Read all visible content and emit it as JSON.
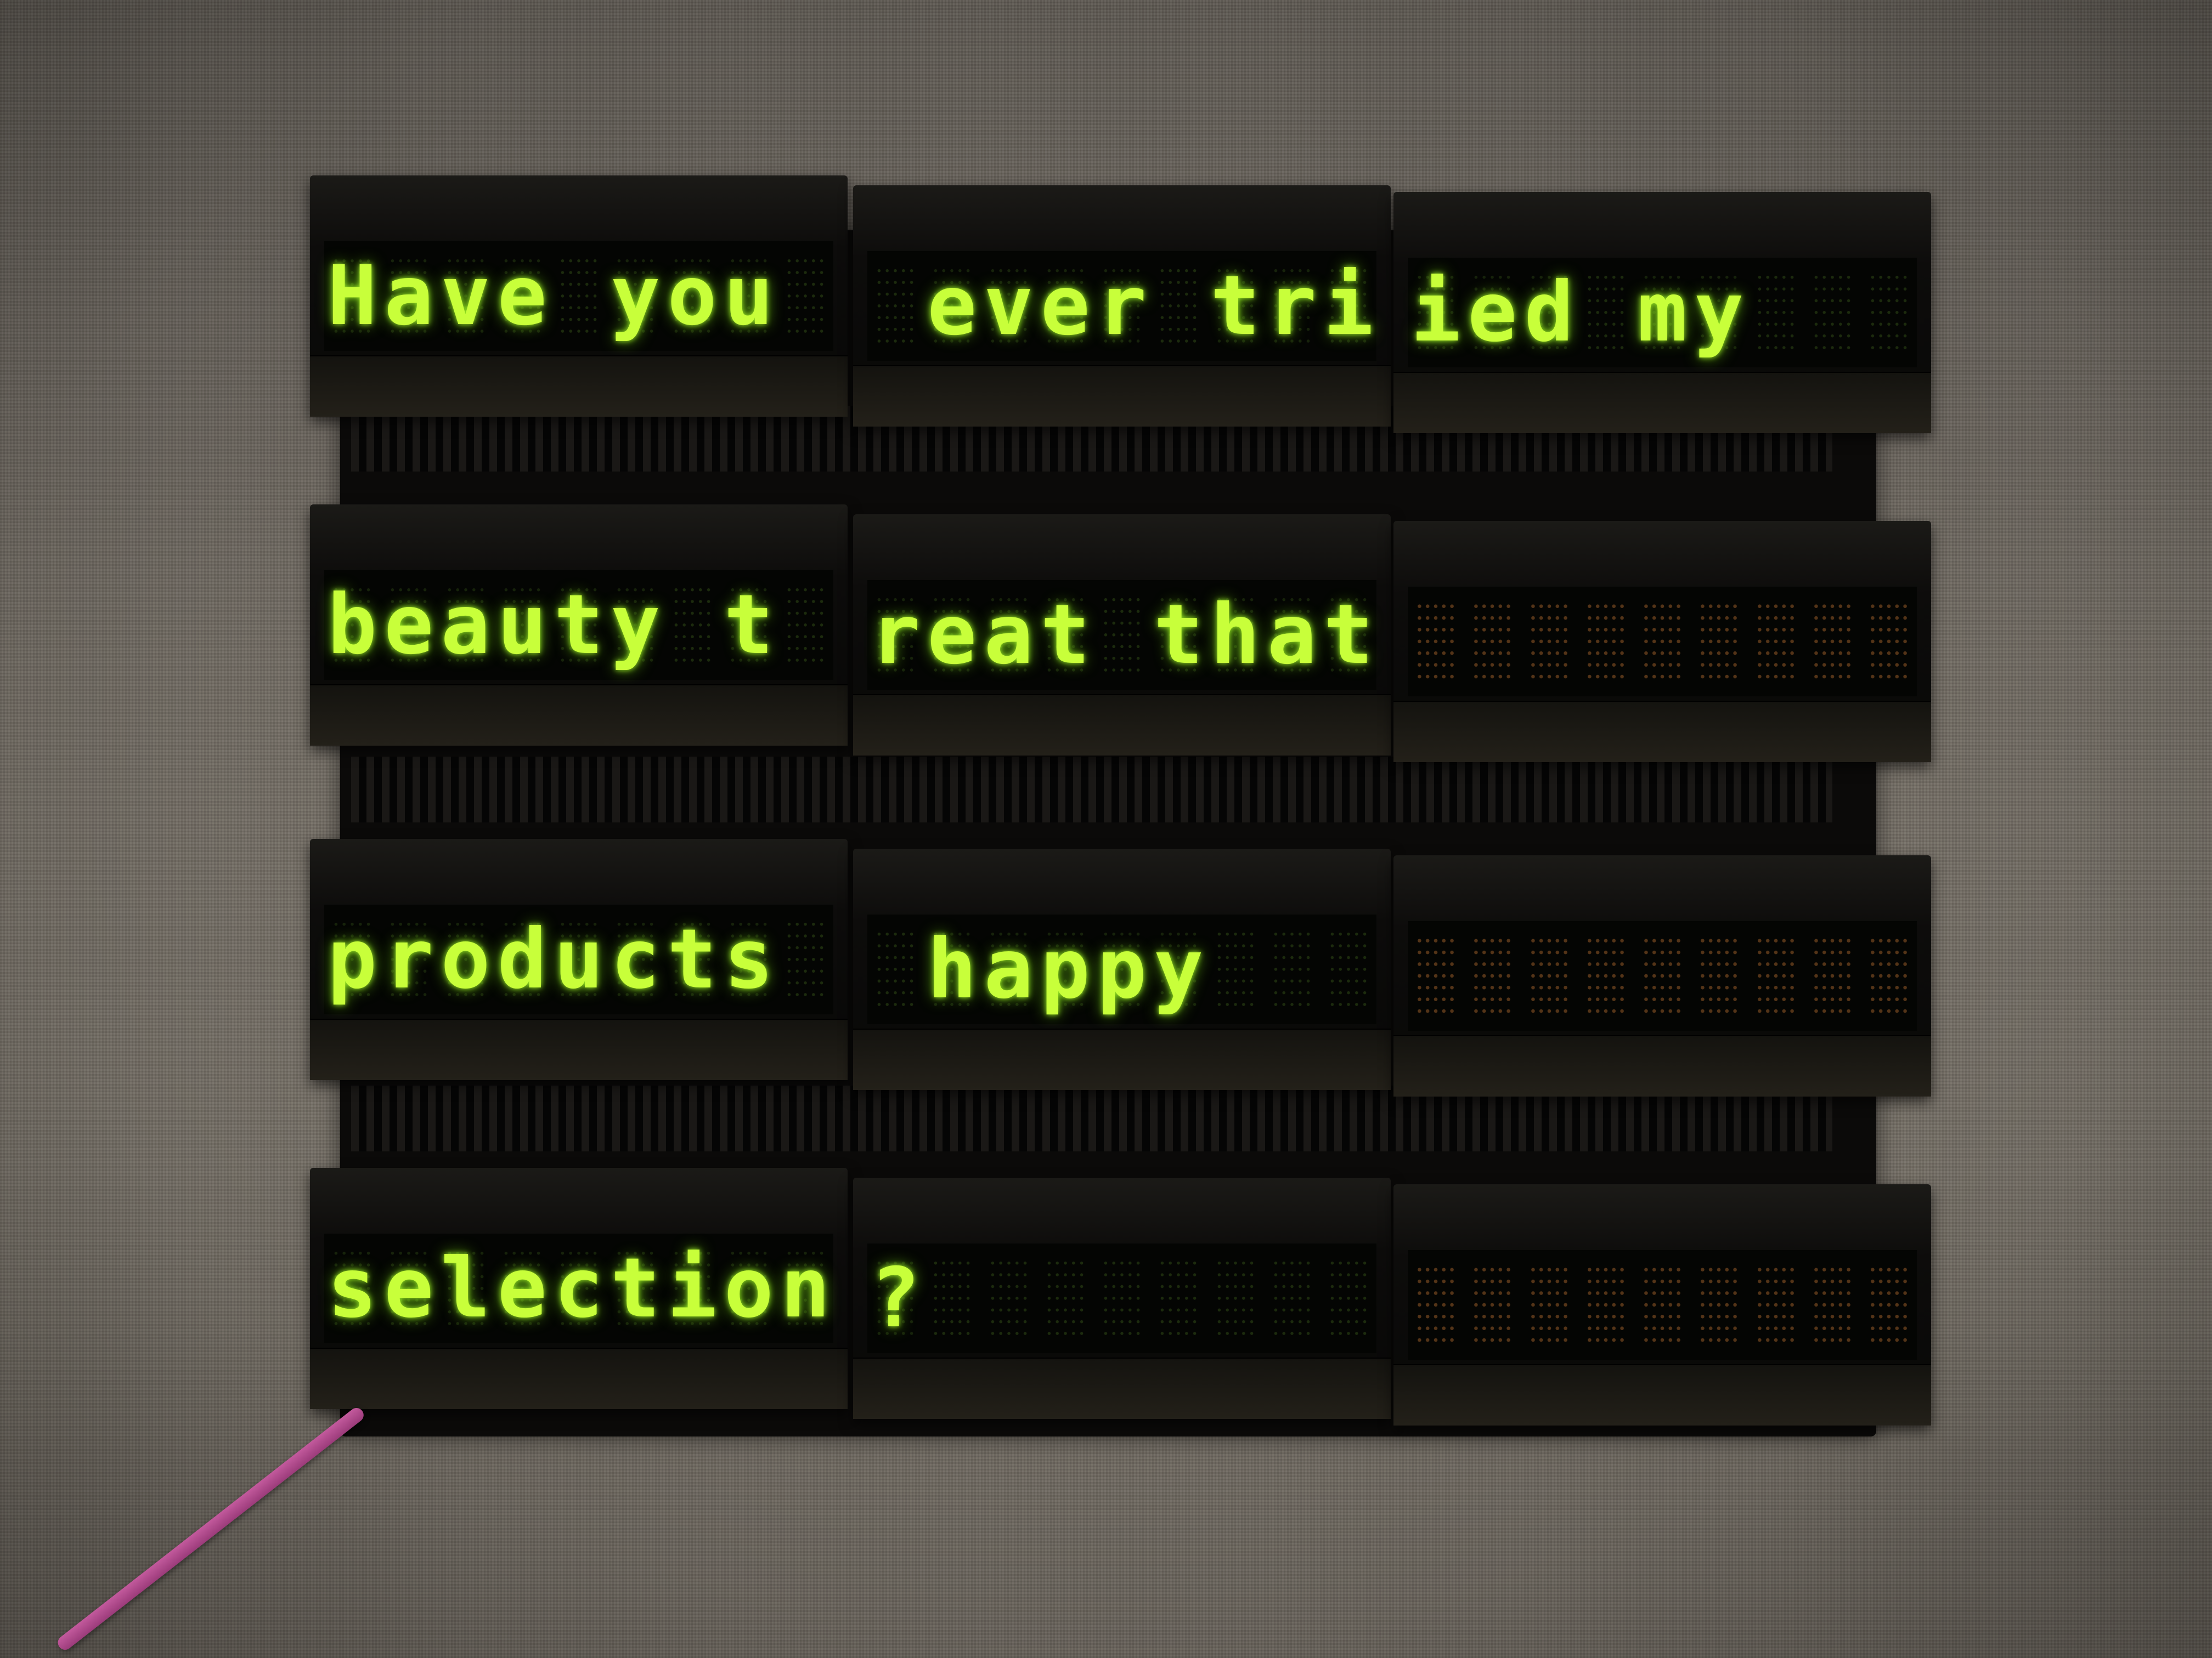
{
  "display": {
    "rows": [
      {
        "modules": [
          "Have you ",
          " ever tri",
          "ied my   "
        ]
      },
      {
        "modules": [
          "beauty t",
          "reat that",
          "         "
        ]
      },
      {
        "modules": [
          "products ",
          " happy   ",
          "         "
        ]
      },
      {
        "modules": [
          "selection",
          "?        ",
          "         "
        ]
      }
    ],
    "lit_color": "#c8ff3a",
    "unlit_color": "#965a28"
  }
}
